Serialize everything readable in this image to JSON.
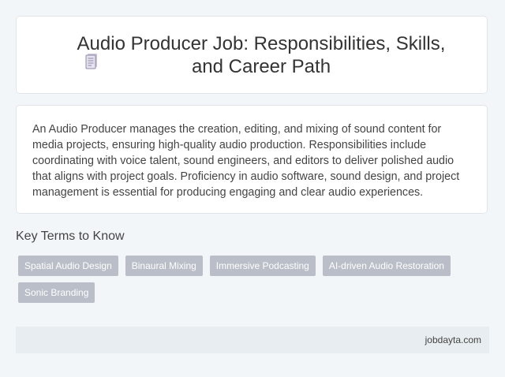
{
  "header": {
    "icon": "document-icon",
    "title": "Audio Producer Job: Responsibilities, Skills, and Career Path"
  },
  "description": {
    "text": "An Audio Producer manages the creation, editing, and mixing of sound content for media projects, ensuring high-quality audio production. Responsibilities include coordinating with voice talent, sound engineers, and editors to deliver polished audio that aligns with project goals. Proficiency in audio software, sound design, and project management is essential for producing engaging and clear audio experiences."
  },
  "key_terms": {
    "heading": "Key Terms to Know",
    "tags": [
      "Spatial Audio Design",
      "Binaural Mixing",
      "Immersive Podcasting",
      "AI-driven Audio Restoration",
      "Sonic Branding"
    ]
  },
  "footer": {
    "site": "jobdayta.com"
  },
  "colors": {
    "background": "#f3f6f9",
    "tag_background": "#b9bec8",
    "footer_background": "#e7edf0"
  }
}
